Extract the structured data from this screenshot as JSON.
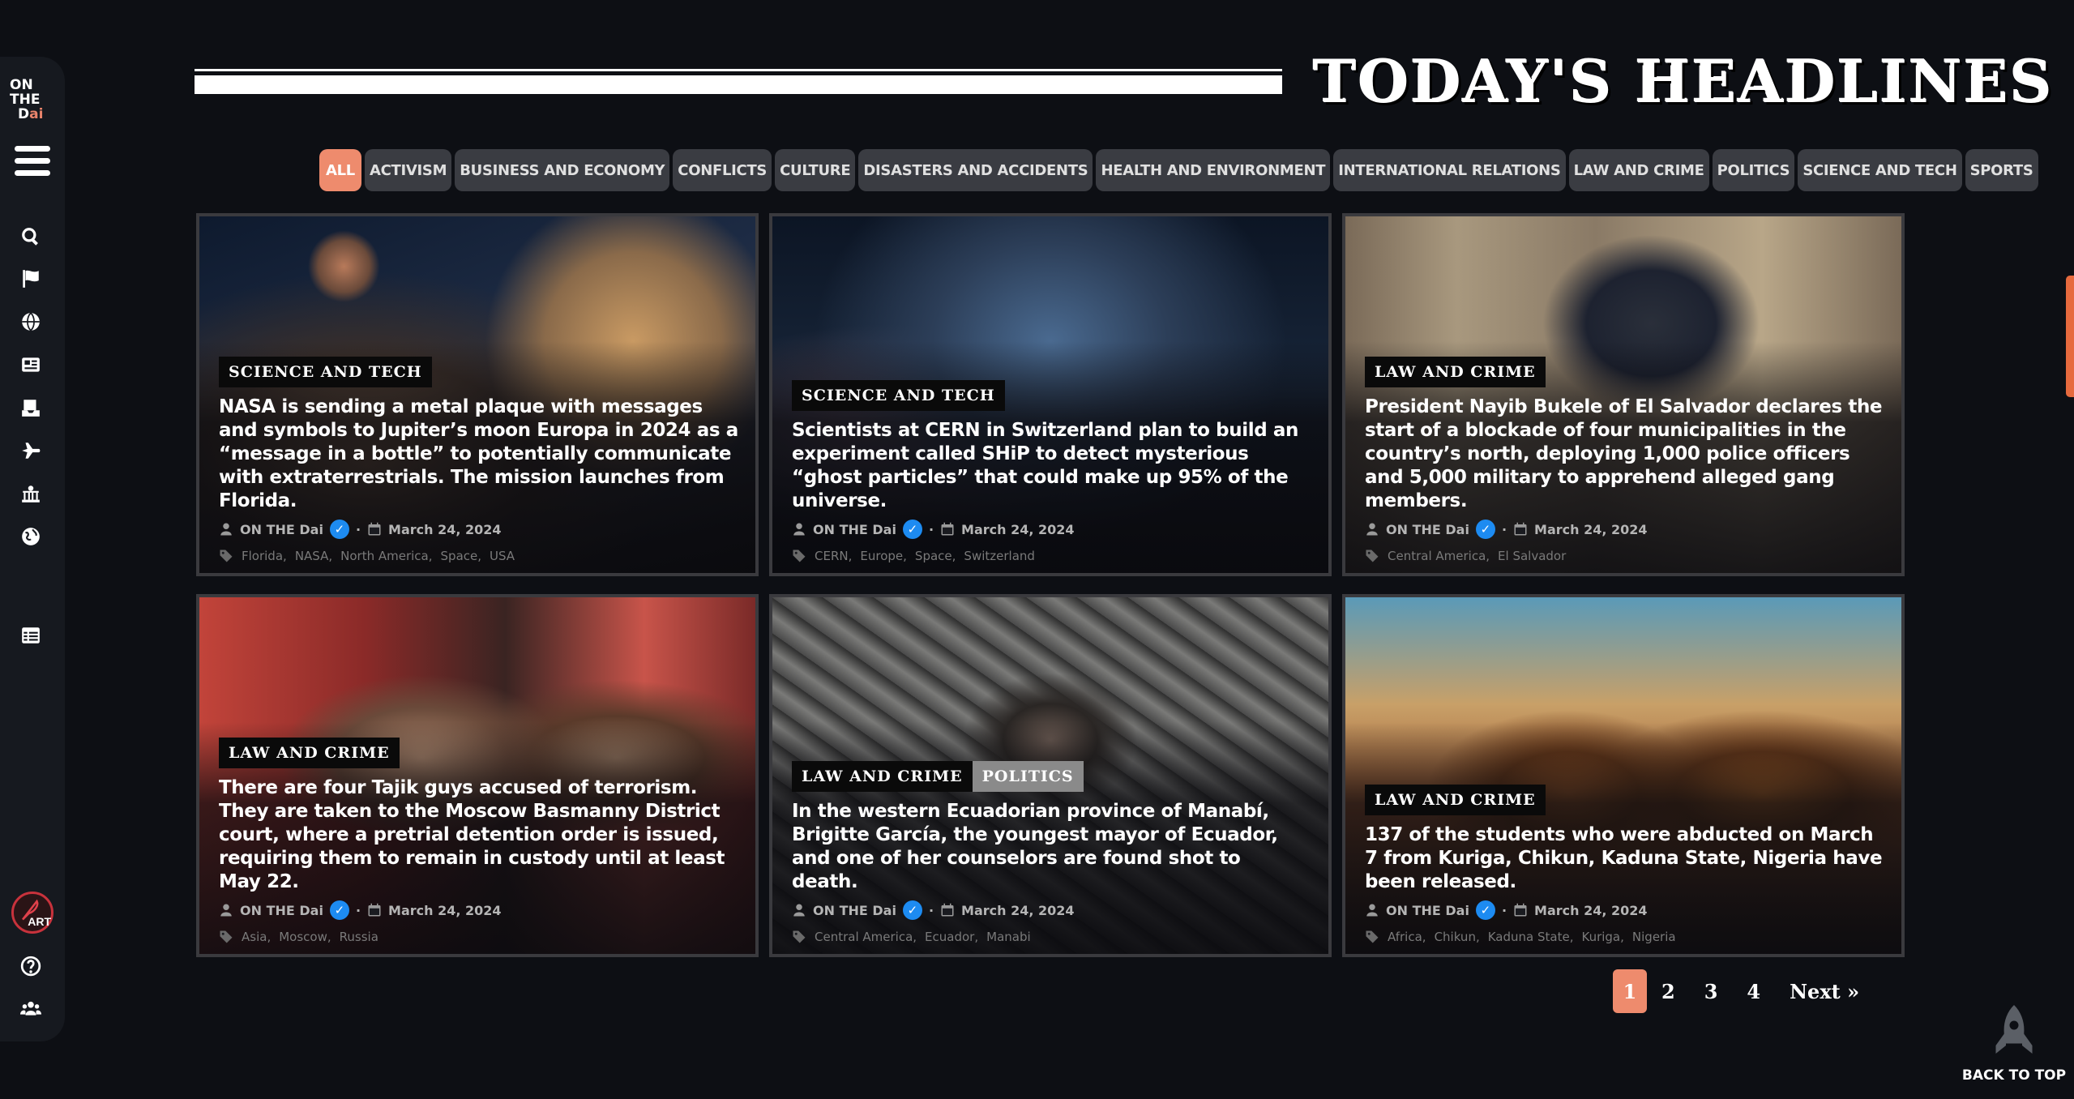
{
  "sidebar": {
    "logo_line1": "ON",
    "logo_line2": "THE",
    "logo_line3a": "D",
    "logo_line3b": "ai",
    "icons": [
      "search-icon",
      "flag-icon",
      "globe-icon",
      "newspaper-icon",
      "inbox-icon",
      "plane-icon",
      "landmark-icon",
      "earth-icon",
      "list-icon"
    ],
    "art_label": "ART",
    "bottom_icons": [
      "help-icon",
      "users-icon"
    ]
  },
  "header": {
    "title": "TODAY'S HEADLINES"
  },
  "categories": [
    {
      "label": "ALL",
      "active": true
    },
    {
      "label": "ACTIVISM"
    },
    {
      "label": "BUSINESS AND ECONOMY"
    },
    {
      "label": "CONFLICTS"
    },
    {
      "label": "CULTURE"
    },
    {
      "label": "DISASTERS AND ACCIDENTS"
    },
    {
      "label": "HEALTH AND ENVIRONMENT"
    },
    {
      "label": "INTERNATIONAL RELATIONS"
    },
    {
      "label": "LAW AND CRIME"
    },
    {
      "label": "POLITICS"
    },
    {
      "label": "SCIENCE AND TECH"
    },
    {
      "label": "SPORTS"
    }
  ],
  "cards": [
    {
      "badges": [
        "SCIENCE AND TECH"
      ],
      "title": "NASA is sending a metal plaque with messages and symbols to Jupiter’s moon Europa in 2024 as a “message in a bottle” to potentially communicate with extraterrestrials. The mission launches from Florida.",
      "author": "ON THE Dai",
      "date": "March 24, 2024",
      "tags": [
        "Florida",
        "NASA",
        "North America",
        "Space",
        "USA"
      ]
    },
    {
      "badges": [
        "SCIENCE AND TECH"
      ],
      "title": "Scientists at CERN in Switzerland plan to build an experiment called SHiP to detect mysterious “ghost particles” that could make up 95% of the universe.",
      "author": "ON THE Dai",
      "date": "March 24, 2024",
      "tags": [
        "CERN",
        "Europe",
        "Space",
        "Switzerland"
      ]
    },
    {
      "badges": [
        "LAW AND CRIME"
      ],
      "title": "President Nayib Bukele of El Salvador declares the start of a blockade of four municipalities in the country’s north, deploying 1,000 police officers and 5,000 military to apprehend alleged gang members.",
      "author": "ON THE Dai",
      "date": "March 24, 2024",
      "tags": [
        "Central America",
        "El Salvador"
      ]
    },
    {
      "badges": [
        "LAW AND CRIME"
      ],
      "title": "There are four Tajik guys accused of terrorism. They are taken to the Moscow Basmanny District court, where a pretrial detention order is issued, requiring them to remain in custody until at least May 22.",
      "author": "ON THE Dai",
      "date": "March 24, 2024",
      "tags": [
        "Asia",
        "Moscow",
        "Russia"
      ]
    },
    {
      "badges": [
        "LAW AND CRIME",
        "POLITICS"
      ],
      "title": "In the western Ecuadorian province of Manabí, Brigitte García, the youngest mayor of Ecuador, and one of her counselors are found shot to death.",
      "author": "ON THE Dai",
      "date": "March 24, 2024",
      "tags": [
        "Central America",
        "Ecuador",
        "Manabi"
      ]
    },
    {
      "badges": [
        "LAW AND CRIME"
      ],
      "title": "137 of the students who were abducted on March 7 from Kuriga, Chikun, Kaduna State, Nigeria have been released.",
      "author": "ON THE Dai",
      "date": "March 24, 2024",
      "tags": [
        "Africa",
        "Chikun",
        "Kaduna State",
        "Kuriga",
        "Nigeria"
      ]
    }
  ],
  "pagination": {
    "pages": [
      "1",
      "2",
      "3",
      "4"
    ],
    "current": "1",
    "next_label": "Next »"
  },
  "back_to_top": "BACK TO TOP"
}
